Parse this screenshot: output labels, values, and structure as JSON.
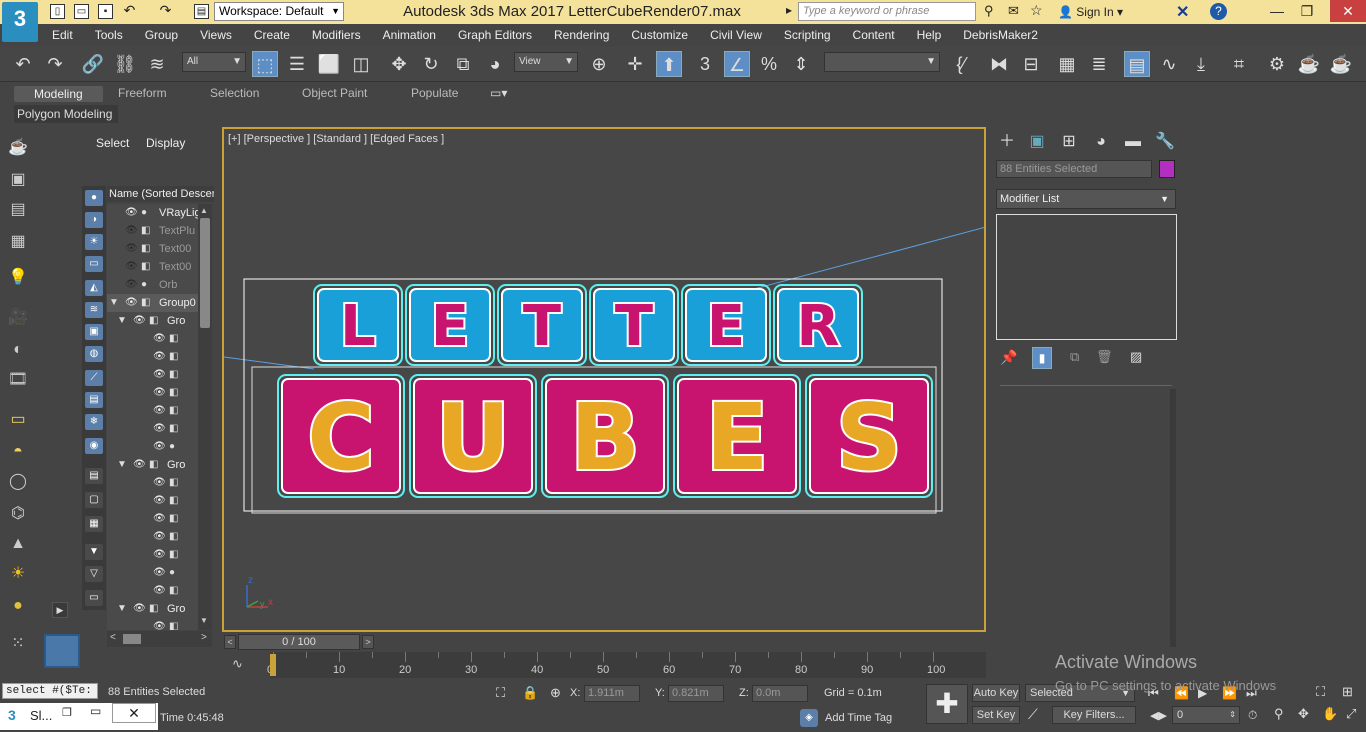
{
  "title_bar": {
    "logo": "3",
    "workspace": "Workspace: Default",
    "title": "Autodesk 3ds Max 2017     LetterCubeRender07.max",
    "search_placeholder": "Type a keyword or phrase",
    "sign_in": "Sign In"
  },
  "menu": [
    "Edit",
    "Tools",
    "Group",
    "Views",
    "Create",
    "Modifiers",
    "Animation",
    "Graph Editors",
    "Rendering",
    "Customize",
    "Civil View",
    "Scripting",
    "Content",
    "Help",
    "DebrisMaker2"
  ],
  "toolbar": {
    "filter": "All",
    "ref_coord": "View",
    "named_sel": ""
  },
  "ribbon": {
    "tabs": [
      "Modeling",
      "Freeform",
      "Selection",
      "Object Paint",
      "Populate"
    ],
    "active": "Modeling",
    "panel": "Polygon Modeling"
  },
  "scene_explorer": {
    "tabs": [
      "Select",
      "Display"
    ],
    "column_header": "Name (Sorted Descen",
    "rows": [
      {
        "name": "VRayLig",
        "dim": false
      },
      {
        "name": "TextPlu",
        "dim": true
      },
      {
        "name": "Text00",
        "dim": true
      },
      {
        "name": "Text00",
        "dim": true
      },
      {
        "name": "Orb",
        "dim": true
      },
      {
        "name": "Group0",
        "dim": false
      },
      {
        "name": "Gro",
        "dim": false
      },
      {
        "name": "",
        "dim": false
      },
      {
        "name": "",
        "dim": false
      },
      {
        "name": "",
        "dim": false
      },
      {
        "name": "",
        "dim": false
      },
      {
        "name": "",
        "dim": false
      },
      {
        "name": "",
        "dim": false
      },
      {
        "name": "",
        "dim": false
      },
      {
        "name": "Gro",
        "dim": false
      },
      {
        "name": "",
        "dim": false
      },
      {
        "name": "",
        "dim": false
      },
      {
        "name": "",
        "dim": false
      },
      {
        "name": "",
        "dim": false
      },
      {
        "name": "",
        "dim": false
      },
      {
        "name": "",
        "dim": false
      },
      {
        "name": "",
        "dim": false
      },
      {
        "name": "Gro",
        "dim": false
      },
      {
        "name": "",
        "dim": false
      }
    ]
  },
  "viewport": {
    "label": "[+] [Perspective ] [Standard ] [Edged Faces ]",
    "row1": [
      "L",
      "E",
      "T",
      "T",
      "E",
      "R"
    ],
    "row2": [
      "C",
      "U",
      "B",
      "E",
      "S"
    ],
    "axis_z": "z",
    "axis_x": "x",
    "axis_y": "y"
  },
  "command_panel": {
    "selection": "88 Entities Selected",
    "selection_color": "#b32fbf",
    "modifier_list": "Modifier List"
  },
  "timeline": {
    "slider": "0 / 100",
    "ticks": [
      "0",
      "10",
      "20",
      "30",
      "40",
      "50",
      "60",
      "70",
      "80",
      "90",
      "100"
    ]
  },
  "status": {
    "maxscript": "select #($Te:",
    "entities": "88 Entities Selected",
    "render_time": "Time  0:45:48",
    "x_label": "X:",
    "x": "1.911m",
    "y_label": "Y:",
    "y": "0.821m",
    "z_label": "Z:",
    "z": "0.0m",
    "grid": "Grid = 0.1m",
    "add_time_tag": "Add Time Tag",
    "auto_key": "Auto Key",
    "set_key": "Set Key",
    "selected": "Selected",
    "key_filters": "Key Filters...",
    "frame": "0",
    "taskbar_app": "Sl..."
  },
  "watermark": {
    "line1": "Activate Windows",
    "line2": "Go to PC settings to activate Windows"
  }
}
